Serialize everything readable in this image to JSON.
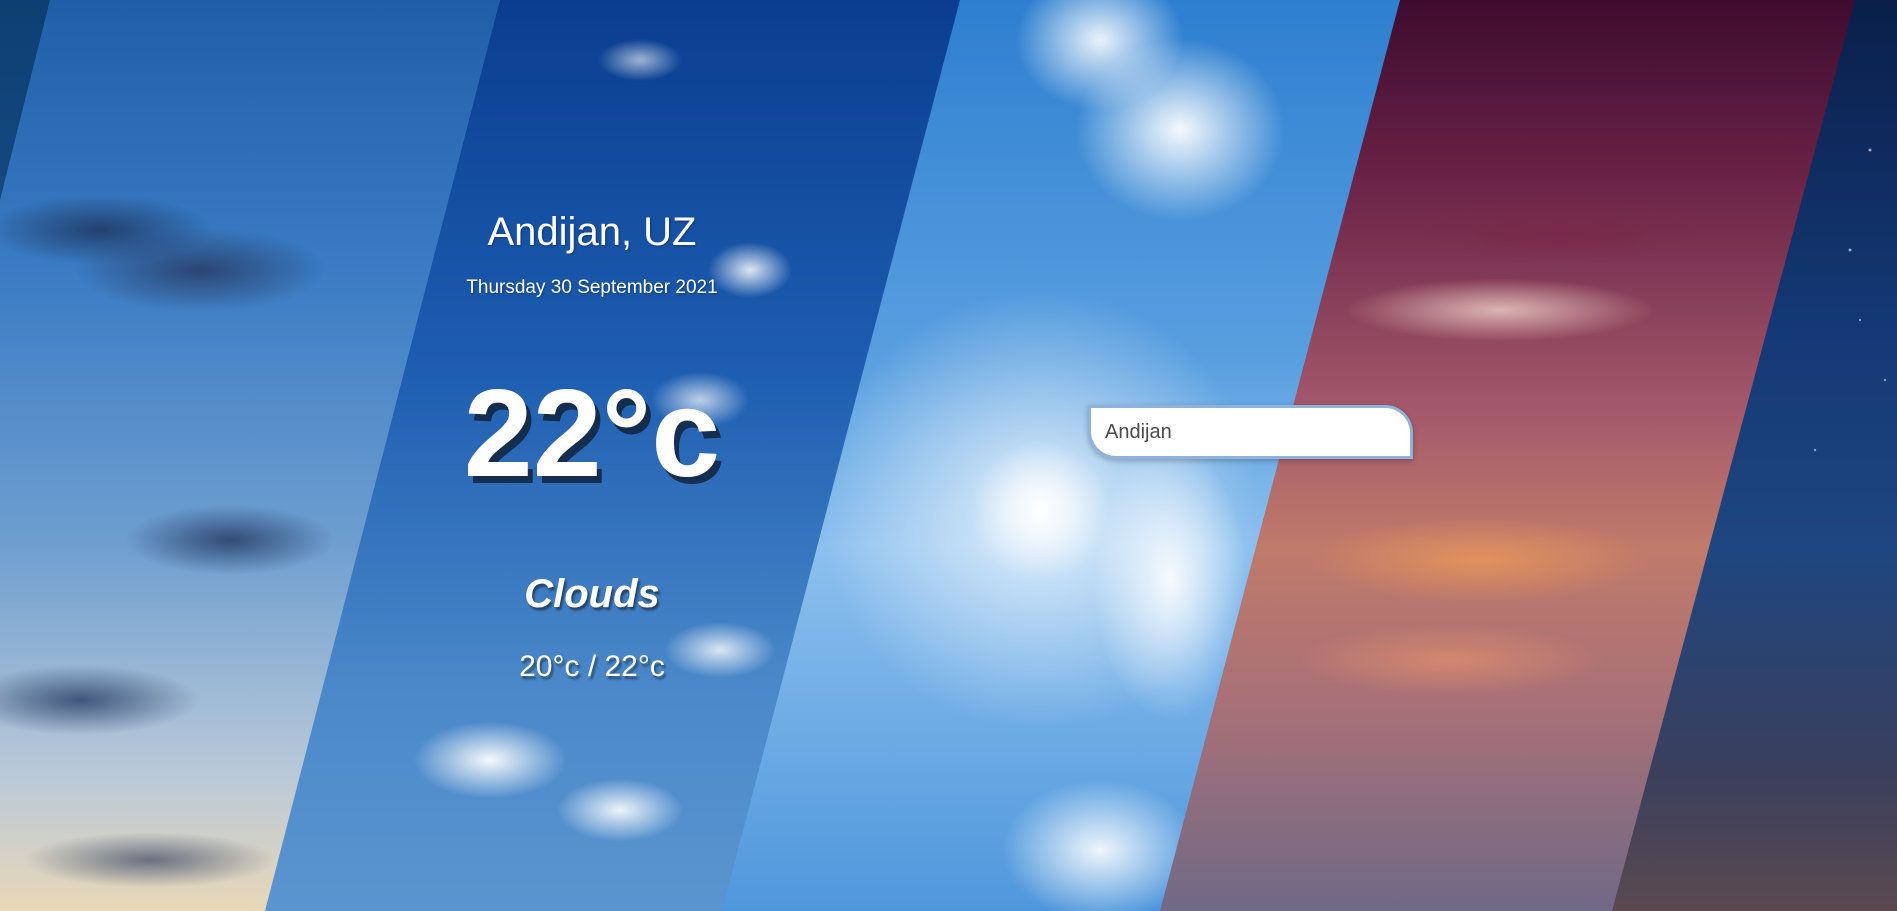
{
  "weather": {
    "location": "Andijan, UZ",
    "date": "Thursday 30 September 2021",
    "temperature": "22°c",
    "condition": "Clouds",
    "hi_low": "20°c / 22°c"
  },
  "search": {
    "value": "Andijan",
    "placeholder": ""
  },
  "icons": {
    "moon": "crescent-moon"
  },
  "colors": {
    "text": "#ffffff",
    "search_border": "#8fb2da",
    "temperature_shadow": "#12233c"
  }
}
